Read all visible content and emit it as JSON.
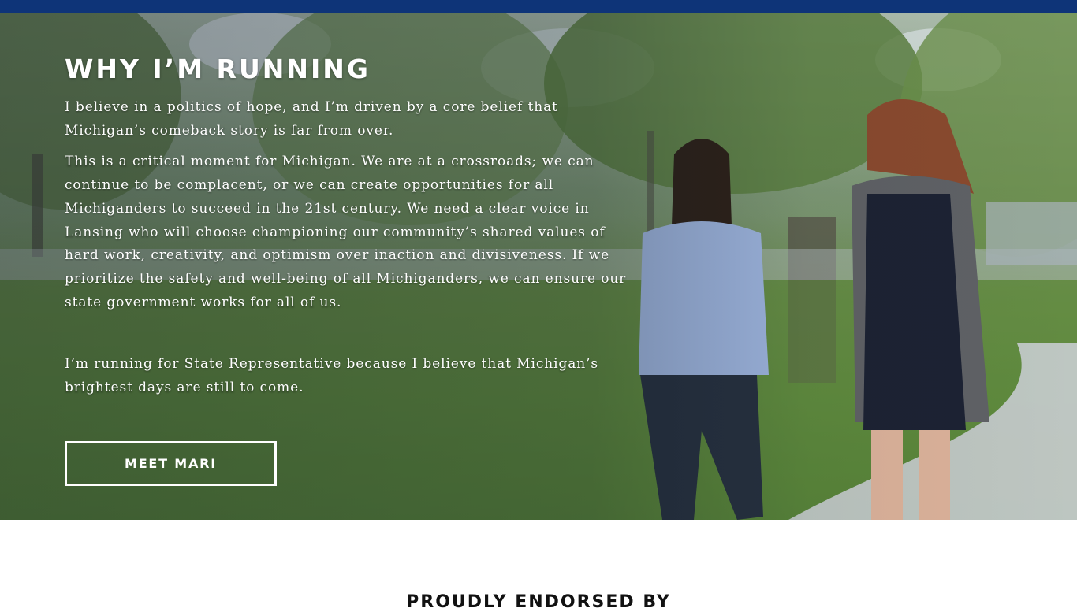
{
  "colors": {
    "top_bar": "#0e3478",
    "heading_text": "#ffffff",
    "button_border": "#ffffff",
    "endorse_text": "#111111"
  },
  "hero": {
    "heading": "WHY I’M RUNNING",
    "paragraphs": [
      "I believe in a politics of hope, and I’m driven by a core belief that Michigan’s comeback story is far from over.",
      "This is a critical moment for Michigan. We are at a crossroads; we can continue to be complacent, or we can create opportunities for all Michiganders to succeed in the 21st century. We need a clear voice in Lansing who will choose championing our community’s shared values of hard work, creativity, and optimism over inaction and divisiveness. If we prioritize the safety and well-being of all Michiganders, we can ensure our state government works for all of us.",
      "I’m running for State Representative because I believe that Michigan’s brightest days are still to come."
    ],
    "button_label": "MEET MARI"
  },
  "endorsements": {
    "heading": "PROUDLY ENDORSED BY"
  }
}
